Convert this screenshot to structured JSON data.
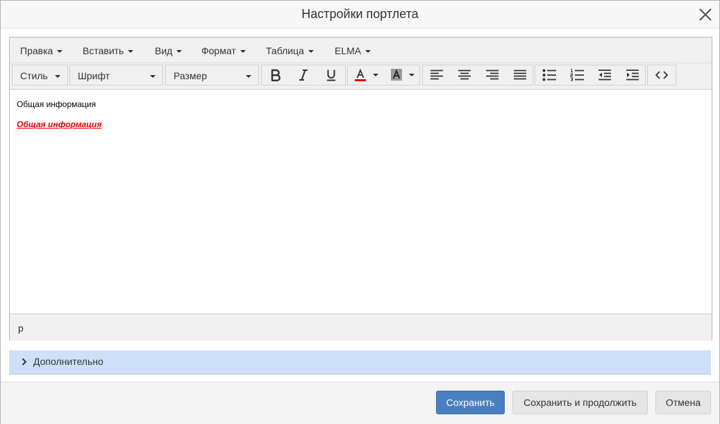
{
  "dialog": {
    "title": "Настройки портлета"
  },
  "menubar": {
    "items": [
      "Правка",
      "Вставить",
      "Вид",
      "Формат",
      "Таблица",
      "ELMA"
    ]
  },
  "toolbar": {
    "style_label": "Стиль",
    "font_label": "Шрифт",
    "size_label": "Размер"
  },
  "content": {
    "paragraph_1": "Общая информация",
    "paragraph_2": "Общая информация",
    "paragraph_2_color": "#e00000"
  },
  "statusbar": {
    "path": "p"
  },
  "section": {
    "label": "Дополнительно"
  },
  "footer": {
    "save_label": "Сохранить",
    "save_continue_label": "Сохранить и продолжить",
    "cancel_label": "Отмена"
  },
  "colors": {
    "accent": "#4a7fc1",
    "section_bg": "#cde0f8",
    "text_color_indicator": "#e00000"
  }
}
